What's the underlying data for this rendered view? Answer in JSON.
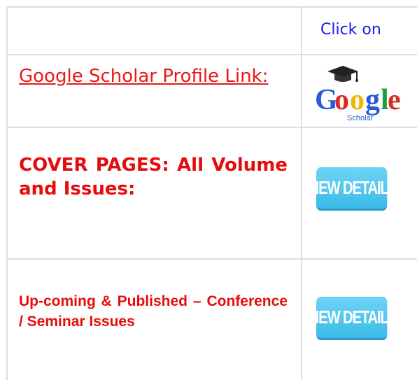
{
  "header": {
    "click_on_label": "Click on"
  },
  "rows": {
    "google_scholar": {
      "link_text": "Google Scholar Profile Link:",
      "logo_word": "Google",
      "logo_sub": "Scholar",
      "logo_icon": "graduation-cap-icon"
    },
    "cover_pages": {
      "label": "COVER PAGES:  All Volume and Issues:",
      "button_label": "VIEW DETAILS"
    },
    "conference": {
      "label": "Up-coming & Published – Conference / Seminar Issues",
      "button_label": "VIEW DETAILS"
    }
  },
  "colors": {
    "link_red": "#e61919",
    "heading_red": "#e60c0c",
    "click_on_blue": "#1a1ae6",
    "button_blue": "#3bbbe9",
    "border_gray": "#dddddd"
  }
}
